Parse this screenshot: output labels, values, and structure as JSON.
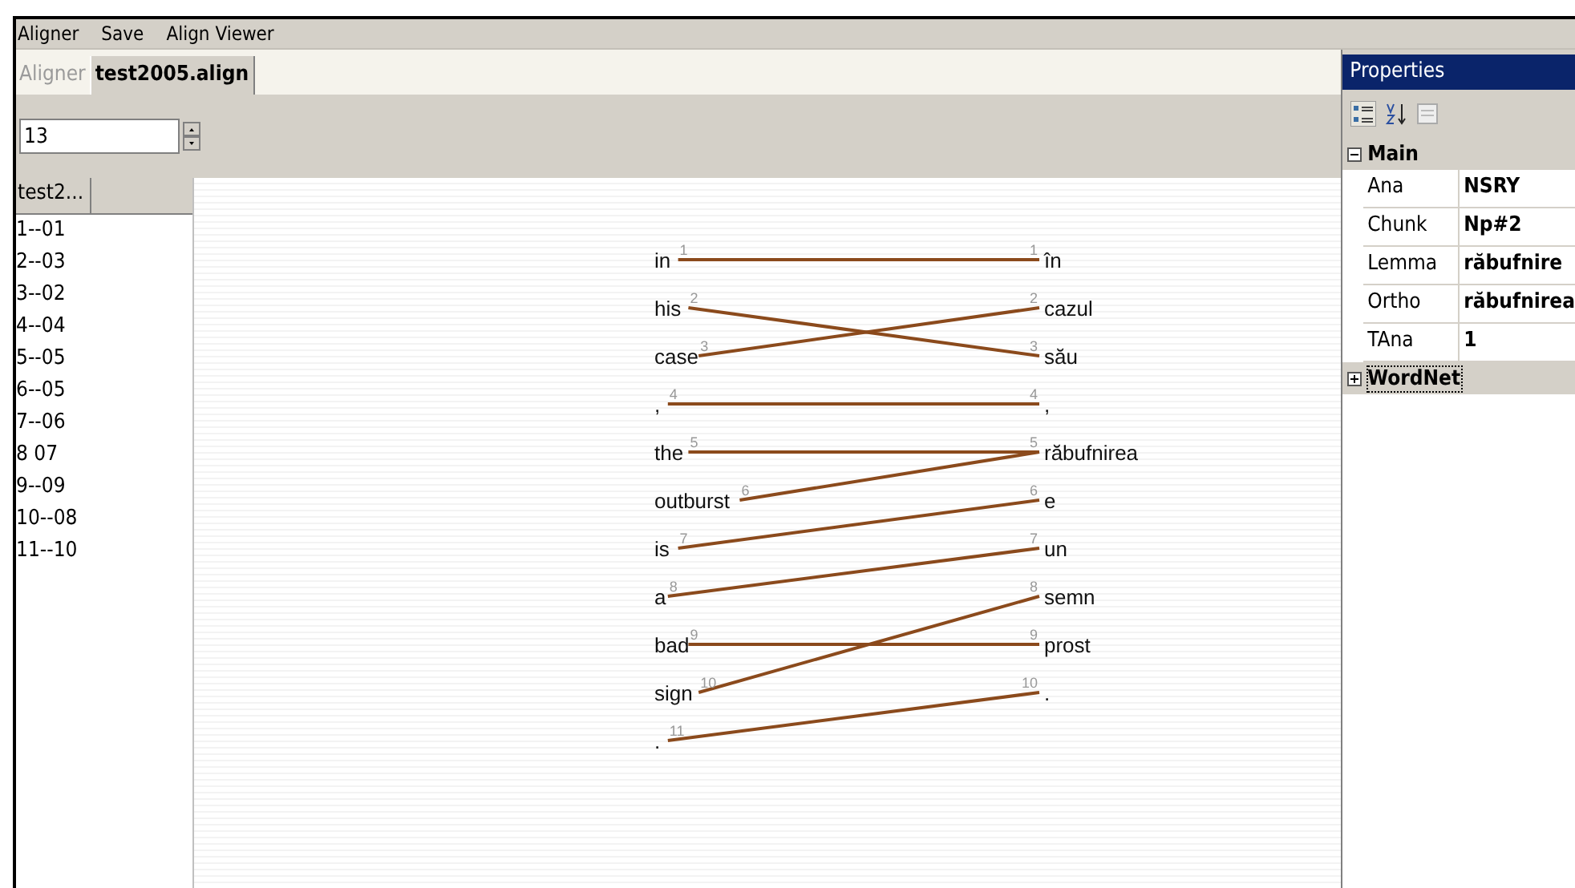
{
  "menu": [
    "Aligner",
    "Save",
    "Align Viewer"
  ],
  "tabs": [
    {
      "label": "Aligner",
      "selected": false
    },
    {
      "label": "test2005.align",
      "selected": true
    }
  ],
  "spinner": {
    "value": "13"
  },
  "pair_list": {
    "header": "test2...",
    "items": [
      "1--01",
      "2--03",
      "3--02",
      "4--04",
      "5--05",
      "6--05",
      "7--06",
      "8  07",
      "9--09",
      "10--08",
      "11--10"
    ]
  },
  "source_words": [
    {
      "word": "in",
      "number": "1"
    },
    {
      "word": "his",
      "number": "2"
    },
    {
      "word": "case",
      "number": "3"
    },
    {
      "word": ",",
      "number": "4"
    },
    {
      "word": "the",
      "number": "5"
    },
    {
      "word": "outburst",
      "number": "6"
    },
    {
      "word": "is",
      "number": "7"
    },
    {
      "word": "a",
      "number": "8"
    },
    {
      "word": "bad",
      "number": "9"
    },
    {
      "word": "sign",
      "number": "10"
    },
    {
      "word": ".",
      "number": "11"
    }
  ],
  "target_words": [
    {
      "word": "în",
      "number": "1"
    },
    {
      "word": "cazul",
      "number": "2"
    },
    {
      "word": "său",
      "number": "3"
    },
    {
      "word": ",",
      "number": "4"
    },
    {
      "word": "răbufnirea",
      "number": "5"
    },
    {
      "word": "e",
      "number": "6"
    },
    {
      "word": "un",
      "number": "7"
    },
    {
      "word": "semn",
      "number": "8"
    },
    {
      "word": "prost",
      "number": "9"
    },
    {
      "word": ".",
      "number": "10"
    }
  ],
  "properties": {
    "title": "Properties",
    "categories": [
      {
        "name": "Main",
        "expanded": true,
        "rows": [
          {
            "name": "Ana",
            "value": "NSRY"
          },
          {
            "name": "Chunk",
            "value": "Np#2"
          },
          {
            "name": "Lemma",
            "value": "răbufnire"
          },
          {
            "name": "Ortho",
            "value": "răbufnirea"
          },
          {
            "name": "TAna",
            "value": "1"
          }
        ]
      },
      {
        "name": "WordNet",
        "expanded": false
      }
    ]
  }
}
